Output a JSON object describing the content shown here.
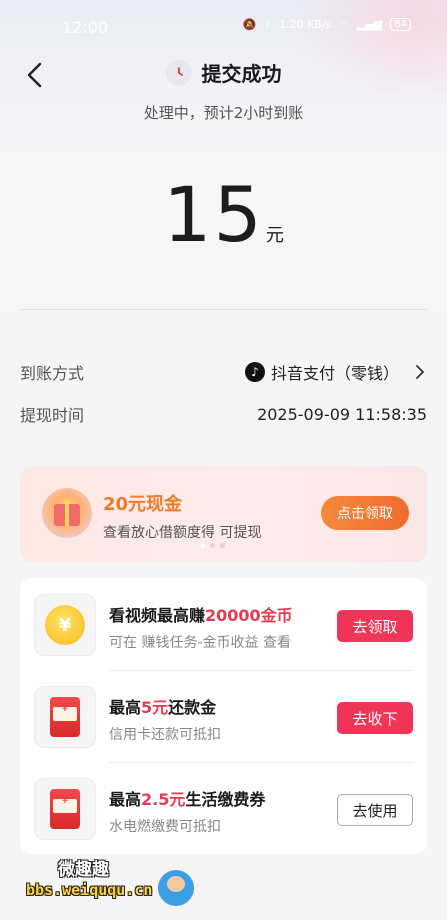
{
  "status_bar": {
    "time": "12:00",
    "network_speed": "1.20 KB/s",
    "battery": "84"
  },
  "header": {
    "title": "提交成功",
    "subtitle": "处理中，预计2小时到账"
  },
  "amount": {
    "value": "15",
    "unit": "元"
  },
  "details": [
    {
      "label": "到账方式",
      "value": "抖音支付（零钱）"
    },
    {
      "label": "提现时间",
      "value": "2025-09-09 11:58:35"
    }
  ],
  "promo": {
    "title": "20元现金",
    "desc": "查看放心借额度得 可提现",
    "button": "点击领取"
  },
  "tasks": [
    {
      "title_pre": "看视频最高赚",
      "title_hl": "20000金币",
      "title_post": "",
      "desc": "可在 赚钱任务-金币收益 查看",
      "button": "去领取",
      "icon": "coin-icon"
    },
    {
      "title_pre": "最高",
      "title_hl": "5元",
      "title_post": "还款金",
      "desc": "信用卡还款可抵扣",
      "button": "去收下",
      "icon": "red-envelope-icon"
    },
    {
      "title_pre": "最高",
      "title_hl": "2.5元",
      "title_post": "生活缴费券",
      "desc": "水电燃缴费可抵扣",
      "button": "去使用",
      "icon": "red-envelope-icon"
    }
  ],
  "watermark": {
    "line1": "微趣趣",
    "line2": "bbs.weiququ.cn"
  },
  "colors": {
    "accent_red": "#f03558",
    "promo_orange": "#ef7a2b",
    "highlight": "#e83a52"
  }
}
